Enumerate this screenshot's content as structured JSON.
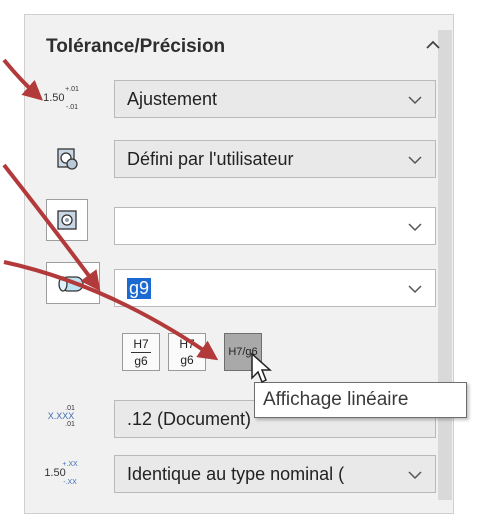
{
  "panel": {
    "title": "Tolérance/Précision",
    "collapse_icon": "chevron-up-icon"
  },
  "rows": {
    "tolerance_type": {
      "icon": "tolerance-type-icon",
      "icon_main": "1.50",
      "icon_upper": "+.01",
      "icon_lower": "-.01",
      "value": "Ajustement"
    },
    "classification": {
      "icon": "fit-classification-icon",
      "value": "Défini par l'utilisateur"
    },
    "hole_fit": {
      "icon": "hole-fit-icon",
      "value": ""
    },
    "shaft_fit": {
      "icon": "shaft-fit-icon",
      "value": "g9"
    },
    "primary_precision": {
      "icon": "primary-precision-icon",
      "icon_main": "X.XXX",
      "icon_upper": ".01",
      "icon_lower": ".01",
      "value": ".12 (Document)"
    },
    "tolerance_precision": {
      "icon": "tolerance-precision-icon",
      "icon_main": "1.50",
      "icon_upper": "+.XX",
      "icon_lower": "-.XX",
      "value": "Identique au type nominal ("
    }
  },
  "fit_display_buttons": [
    {
      "top": "H7",
      "bottom": "g6",
      "name": "stacked-with-line"
    },
    {
      "top": "H7",
      "bottom": "g6",
      "name": "stacked-no-line"
    },
    {
      "label": "H7/g6",
      "name": "linear"
    }
  ],
  "tooltip": "Affichage linéaire",
  "colors": {
    "panel_bg": "#f1f1f1",
    "selection": "#1b6ad2",
    "arrow": "#b23a3a"
  }
}
